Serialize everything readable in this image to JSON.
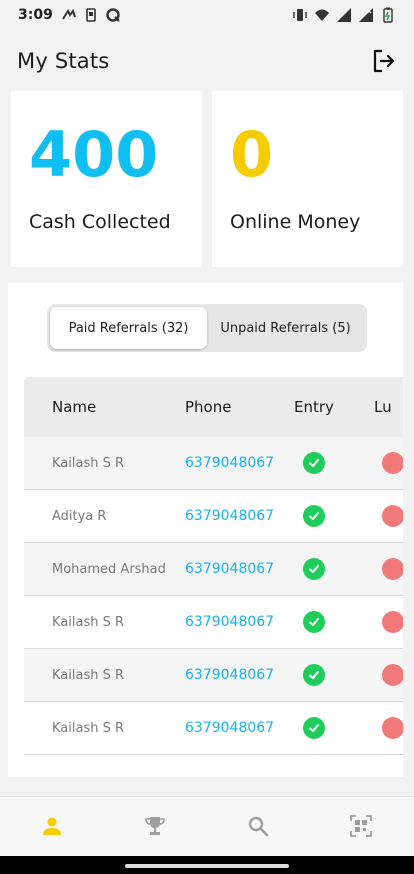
{
  "status_bar": {
    "time": "3:09"
  },
  "header": {
    "title": "My Stats"
  },
  "cards": [
    {
      "value": "400",
      "label": "Cash Collected",
      "color": "#0fbff2"
    },
    {
      "value": "0",
      "label": "Online Money",
      "color": "#f5cc00"
    }
  ],
  "tabs": [
    {
      "label": "Paid Referrals (32)",
      "active": true
    },
    {
      "label": "Unpaid Referrals (5)",
      "active": false
    }
  ],
  "table": {
    "columns": [
      "Name",
      "Phone",
      "Entry",
      "Lu"
    ],
    "rows": [
      {
        "name": "Kailash S R",
        "phone": "6379048067"
      },
      {
        "name": "Aditya R",
        "phone": "6379048067"
      },
      {
        "name": "Mohamed Arshad",
        "phone": "6379048067"
      },
      {
        "name": "Kailash S R",
        "phone": "6379048067"
      },
      {
        "name": "Kailash S R",
        "phone": "6379048067"
      },
      {
        "name": "Kailash S R",
        "phone": "6379048067"
      }
    ]
  },
  "bottom_nav": {
    "items": [
      "profile-icon",
      "trophy-icon",
      "search-icon",
      "qr-scan-icon"
    ],
    "active_color": "#f5cc00"
  }
}
